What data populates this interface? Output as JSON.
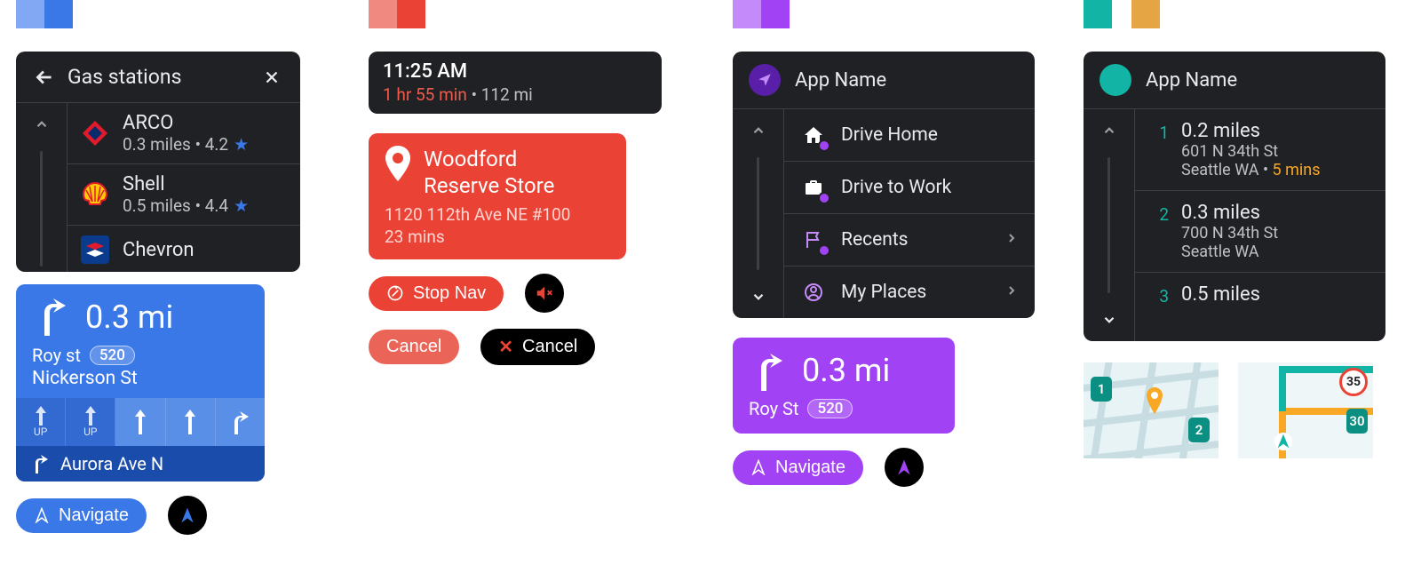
{
  "colors": {
    "blue_light": "#82a8f4",
    "blue": "#3b78e7",
    "red_light": "#f08a80",
    "red": "#ea4335",
    "purple_light": "#c58af9",
    "purple": "#a142f4",
    "teal": "#12b5a5",
    "amber": "#e6a545"
  },
  "blue": {
    "header_title": "Gas stations",
    "items": [
      {
        "name": "ARCO",
        "sub": "0.3 miles • 4.2"
      },
      {
        "name": "Shell",
        "sub": "0.5 miles • 4.4"
      },
      {
        "name": "Chevron",
        "sub": ""
      }
    ],
    "nav": {
      "distance": "0.3 mi",
      "street1": "Roy st",
      "route_badge": "520",
      "street2": "Nickerson St",
      "lane_up": "UP",
      "upcoming": "Aurora Ave N"
    },
    "buttons": {
      "navigate": "Navigate"
    }
  },
  "red": {
    "trip": {
      "clock": "11:25 AM",
      "remaining": "1 hr 55 min",
      "sep": " • ",
      "distance": "112 mi"
    },
    "dest": {
      "name_line1": "Woodford",
      "name_line2": "Reserve Store",
      "address": "1120 112th Ave NE #100",
      "eta": "23 mins"
    },
    "buttons": {
      "stop_nav": "Stop Nav",
      "cancel": "Cancel",
      "cancel2": "Cancel"
    }
  },
  "purple": {
    "app_title": "App Name",
    "menu": [
      {
        "label": "Drive Home"
      },
      {
        "label": "Drive to Work"
      },
      {
        "label": "Recents"
      },
      {
        "label": "My Places"
      }
    ],
    "nav": {
      "distance": "0.3 mi",
      "street": "Roy St",
      "route_badge": "520"
    },
    "buttons": {
      "navigate": "Navigate"
    }
  },
  "teal": {
    "app_title": "App Name",
    "rows": [
      {
        "idx": "1",
        "title": "0.2 miles",
        "line1": "601 N 34th St",
        "line2_a": "Seattle WA • ",
        "line2_b": "5 mins"
      },
      {
        "idx": "2",
        "title": "0.3 miles",
        "line1": "700 N 34th St",
        "line2_a": "Seattle WA",
        "line2_b": ""
      },
      {
        "idx": "3",
        "title": "0.5 miles",
        "line1": "",
        "line2_a": "",
        "line2_b": ""
      }
    ],
    "map": {
      "marker1": "1",
      "marker2": "2",
      "marker30": "30",
      "speed": "35"
    }
  }
}
